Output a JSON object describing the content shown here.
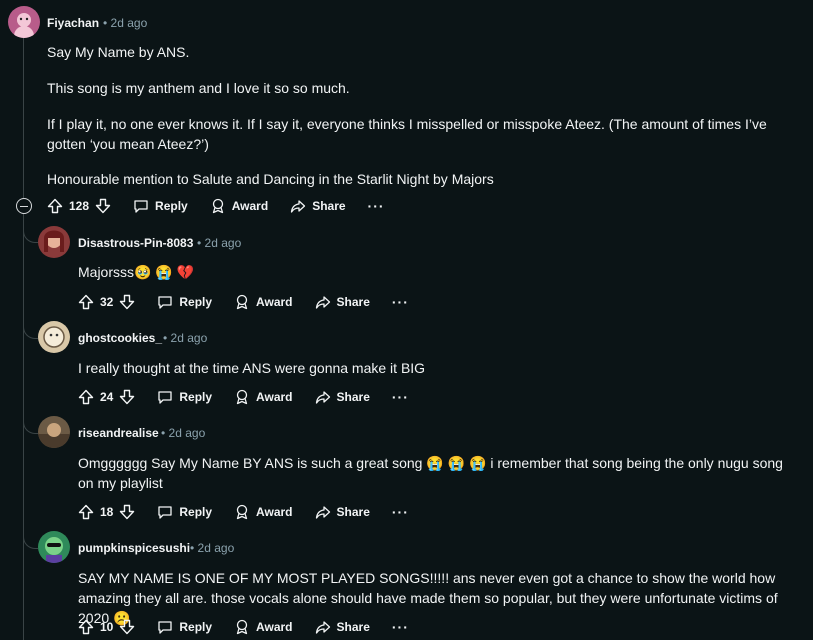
{
  "comments": [
    {
      "author": "Fiyachan",
      "time": "2d ago",
      "paragraphs": [
        "Say My Name by ANS.",
        "This song is my anthem and I love it so so much.",
        "If I play it, no one ever knows it. If I say it, everyone thinks I misspelled or misspoke Ateez. (The amount of times I’ve gotten ‘you mean Ateez?’)",
        "Honourable mention to Salute and Dancing in the Starlit Night by Majors"
      ],
      "votes": "128",
      "colors": {
        "avatar_bg": "#b85c8a"
      }
    },
    {
      "author": "Disastrous-Pin-8083",
      "time": "2d ago",
      "text": "Majorsss🥹 😭 💔",
      "votes": "32",
      "colors": {
        "avatar_bg": "#8a3a3a"
      }
    },
    {
      "author": "ghostcookies_",
      "time": "2d ago",
      "text": "I really thought at the time ANS were gonna make it BIG",
      "votes": "24",
      "colors": {
        "avatar_bg": "#d9c8a8"
      }
    },
    {
      "author": "riseandrealise",
      "time": "2d ago",
      "text": "Omgggggg Say My Name BY ANS is such a great song 😭 😭 😭  i remember that song being the only nugu song on my playlist",
      "votes": "18",
      "colors": {
        "avatar_bg": "#6b5a45"
      }
    },
    {
      "author": "pumpkinspicesushi",
      "time": "2d ago",
      "text": "SAY MY NAME IS ONE OF MY MOST PLAYED SONGS!!!!! ans never even got a chance to show the world how amazing they all are. those vocals alone should have made them so popular, but they were unfortunate victims of 2020 ☹️",
      "votes": "10",
      "colors": {
        "avatar_bg": "#2f8a5a"
      }
    }
  ],
  "labels": {
    "reply": "Reply",
    "award": "Award",
    "share": "Share",
    "more": "···",
    "sep": "•"
  },
  "icons": [
    "upvote-icon",
    "downvote-icon",
    "reply-bubble-icon",
    "award-icon",
    "share-arrow-icon",
    "collapse-icon"
  ]
}
